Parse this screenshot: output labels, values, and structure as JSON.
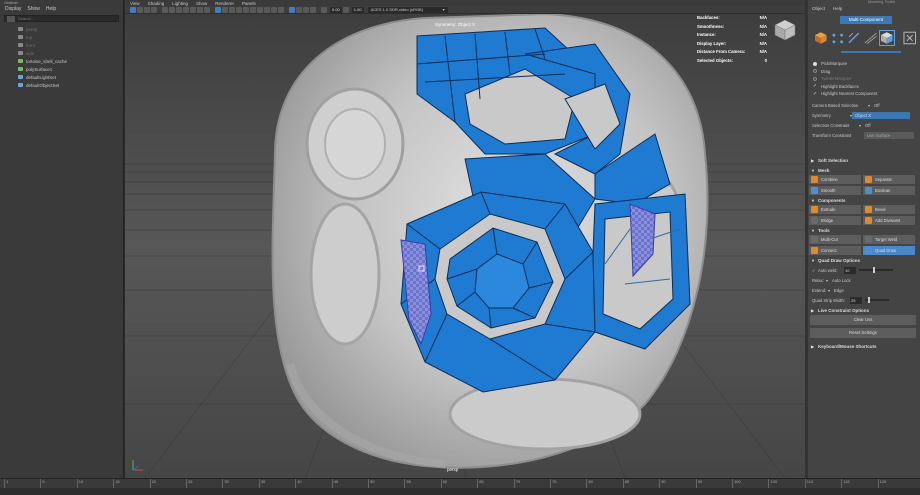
{
  "outliner": {
    "title": "Outliner",
    "menu": [
      "Display",
      "Show",
      "Help"
    ],
    "search_placeholder": "Search...",
    "items": [
      {
        "label": "persp",
        "dim": true,
        "icon": "camera-icon"
      },
      {
        "label": "top",
        "dim": true,
        "icon": "camera-icon"
      },
      {
        "label": "front",
        "dim": true,
        "icon": "camera-icon"
      },
      {
        "label": "side",
        "dim": true,
        "icon": "camera-icon"
      },
      {
        "label": "tortoise_shell_cache",
        "dim": false,
        "icon": "mesh-icon"
      },
      {
        "label": "polySurface1",
        "dim": false,
        "icon": "mesh-icon"
      },
      {
        "label": "defaultLightSet",
        "dim": false,
        "icon": "set-icon"
      },
      {
        "label": "defaultObjectSet",
        "dim": false,
        "icon": "set-icon"
      }
    ]
  },
  "viewport": {
    "menu": [
      "View",
      "Shading",
      "Lighting",
      "Show",
      "Renderer",
      "Panels"
    ],
    "exposure": "0.00",
    "gamma": "1.00",
    "color_space": "ACES 1.0 SDR-video (sRGB)",
    "symmetry_label": "Symmetry: Object X",
    "camera_label": "persp",
    "hud": [
      {
        "label": "Backfaces:",
        "value": "N/A"
      },
      {
        "label": "Smoothness:",
        "value": "N/A"
      },
      {
        "label": "Instance:",
        "value": "N/A"
      },
      {
        "label": "Display Layer:",
        "value": "N/A"
      },
      {
        "label": "Distance From Camera:",
        "value": "N/A"
      },
      {
        "label": "Selected Objects:",
        "value": "0"
      }
    ]
  },
  "toolkit": {
    "tabs": "Modeling Toolkit",
    "menu": [
      "Object",
      "Help"
    ],
    "mode_label": "Multi-Component",
    "pick_options": [
      {
        "label": "Pick/Marquee",
        "on": true
      },
      {
        "label": "Drag",
        "on": false
      },
      {
        "label": "Tweak/Marquee",
        "on": false
      }
    ],
    "checks": [
      "Highlight Backfaces",
      "Highlight Nearest Component"
    ],
    "camera_based": {
      "label": "Camera Based Selection",
      "value": "Off"
    },
    "symmetry": {
      "label": "Symmetry",
      "value": "Object X"
    },
    "selection_constraint": {
      "label": "Selection Constraint",
      "value": "Off"
    },
    "transform_constraint": {
      "label": "Transform Constraint",
      "value": "Live Surface"
    },
    "soft_selection": "Soft Selection",
    "mesh": {
      "title": "Mesh",
      "buttons": [
        {
          "label": "Combine",
          "color": "#e08a30"
        },
        {
          "label": "Separate",
          "color": "#e08a30"
        },
        {
          "label": "Smooth",
          "color": "#4a8fd0"
        },
        {
          "label": "Boolean",
          "color": "#4a8fd0"
        }
      ]
    },
    "components": {
      "title": "Components",
      "buttons": [
        {
          "label": "Extrude",
          "color": "#e08a30"
        },
        {
          "label": "Bevel",
          "color": "#e08a30"
        },
        {
          "label": "Bridge",
          "color": "#6a6a6a"
        },
        {
          "label": "Add Divisions",
          "color": "#e08a30"
        }
      ]
    },
    "tools": {
      "title": "Tools",
      "buttons": [
        {
          "label": "Multi-Cut",
          "color": "#6a6a6a",
          "active": false
        },
        {
          "label": "Target Weld",
          "color": "#6a6a6a",
          "active": false
        },
        {
          "label": "Connect",
          "color": "#e08a30",
          "active": false
        },
        {
          "label": "Quad Draw",
          "color": "#4a8fd0",
          "active": true
        }
      ]
    },
    "quad_draw": {
      "title": "Quad Draw Options",
      "auto_weld": {
        "label": "Auto weld:",
        "value": "10"
      },
      "relax": {
        "label": "Relax:",
        "value": "Auto Lock"
      },
      "extend": {
        "label": "Extend:",
        "value": "Edge"
      },
      "strip_width": {
        "label": "Quad Strip Width:",
        "value": "25"
      }
    },
    "live_constraint": "Live Constraint Options",
    "clear_button": "Clear Uvs",
    "reset_button": "Reset Settings",
    "shortcuts": "Keyboard/Mouse Shortcuts"
  },
  "timeline": {
    "ticks": [
      "1",
      "5",
      "10",
      "15",
      "20",
      "25",
      "30",
      "35",
      "40",
      "45",
      "50",
      "55",
      "60",
      "65",
      "70",
      "75",
      "80",
      "85",
      "90",
      "95",
      "100",
      "105",
      "110",
      "115",
      "120"
    ]
  }
}
